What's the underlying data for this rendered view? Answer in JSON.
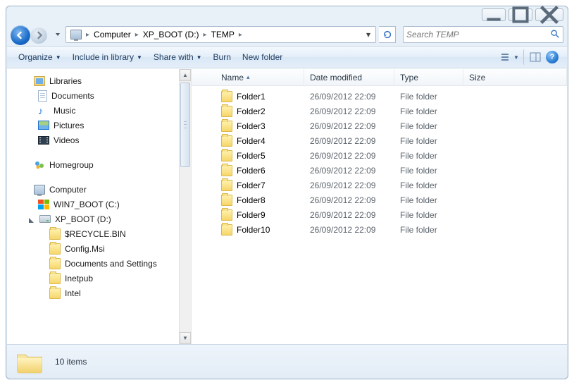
{
  "address": {
    "root_icon": "computer",
    "segments": [
      "Computer",
      "XP_BOOT (D:)",
      "TEMP"
    ]
  },
  "search": {
    "placeholder": "Search TEMP"
  },
  "toolbar": {
    "organize": "Organize",
    "include": "Include in library",
    "share": "Share with",
    "burn": "Burn",
    "newfolder": "New folder"
  },
  "nav": {
    "libraries": {
      "label": "Libraries",
      "items": [
        "Documents",
        "Music",
        "Pictures",
        "Videos"
      ]
    },
    "homegroup": "Homegroup",
    "computer": {
      "label": "Computer",
      "drives": [
        {
          "label": "WIN7_BOOT (C:)",
          "icon": "win"
        },
        {
          "label": "XP_BOOT (D:)",
          "icon": "drive",
          "children": [
            "$RECYCLE.BIN",
            "Config.Msi",
            "Documents and Settings",
            "Inetpub",
            "Intel"
          ]
        }
      ]
    }
  },
  "columns": {
    "name": "Name",
    "date": "Date modified",
    "type": "Type",
    "size": "Size"
  },
  "rows": [
    {
      "name": "Folder1",
      "date": "26/09/2012 22:09",
      "type": "File folder"
    },
    {
      "name": "Folder2",
      "date": "26/09/2012 22:09",
      "type": "File folder"
    },
    {
      "name": "Folder3",
      "date": "26/09/2012 22:09",
      "type": "File folder"
    },
    {
      "name": "Folder4",
      "date": "26/09/2012 22:09",
      "type": "File folder"
    },
    {
      "name": "Folder5",
      "date": "26/09/2012 22:09",
      "type": "File folder"
    },
    {
      "name": "Folder6",
      "date": "26/09/2012 22:09",
      "type": "File folder"
    },
    {
      "name": "Folder7",
      "date": "26/09/2012 22:09",
      "type": "File folder"
    },
    {
      "name": "Folder8",
      "date": "26/09/2012 22:09",
      "type": "File folder"
    },
    {
      "name": "Folder9",
      "date": "26/09/2012 22:09",
      "type": "File folder"
    },
    {
      "name": "Folder10",
      "date": "26/09/2012 22:09",
      "type": "File folder"
    }
  ],
  "status": {
    "count": "10 items"
  }
}
